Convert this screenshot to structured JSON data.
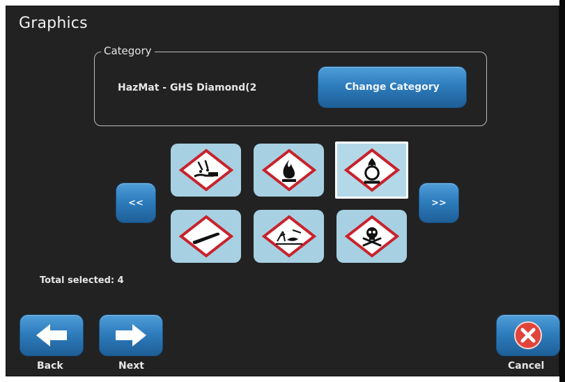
{
  "title": "Graphics",
  "category": {
    "legend": "Category",
    "value": "HazMat - GHS Diamond(2",
    "change_button": "Change Category"
  },
  "pager": {
    "prev": "<<",
    "next": ">>"
  },
  "graphics": [
    {
      "icon": "corrosion-icon",
      "selected": false
    },
    {
      "icon": "flame-icon",
      "selected": false
    },
    {
      "icon": "flame-over-circle-icon",
      "selected": true
    },
    {
      "icon": "gas-cylinder-icon",
      "selected": false
    },
    {
      "icon": "environment-icon",
      "selected": false
    },
    {
      "icon": "skull-crossbones-icon",
      "selected": false
    }
  ],
  "status": "Total selected: 4",
  "buttons": {
    "back": "Back",
    "next": "Next",
    "cancel": "Cancel"
  },
  "colors": {
    "background": "#222222",
    "accent": "#2f7dbd",
    "tile": "#a7d1e2",
    "ghs_red": "#c8232c",
    "cancel_red": "#e0443a"
  }
}
